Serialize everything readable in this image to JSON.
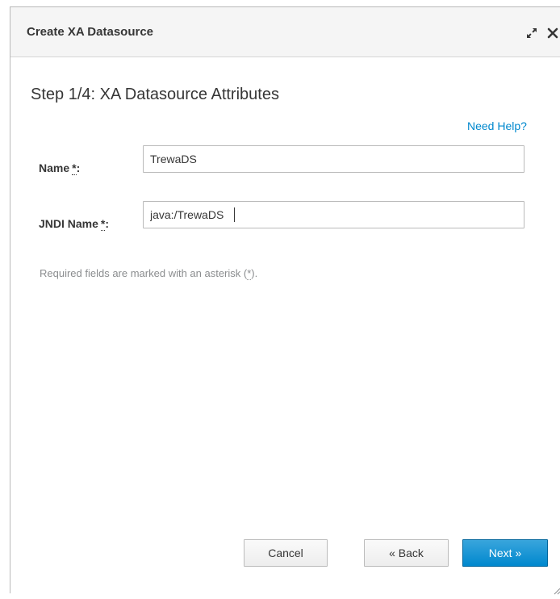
{
  "dialog": {
    "title": "Create XA Datasource"
  },
  "step": {
    "title": "Step 1/4: XA Datasource Attributes"
  },
  "help": {
    "label": "Need Help?"
  },
  "fields": {
    "name": {
      "label": "Name",
      "required_mark": "*",
      "colon": ":",
      "value": "TrewaDS"
    },
    "jndi": {
      "label": "JNDI Name",
      "required_mark": "*",
      "colon": ":",
      "value": "java:/TrewaDS"
    }
  },
  "note": {
    "prefix": "Required fields are marked with an asterisk (",
    "mark": "*",
    "suffix": ")."
  },
  "buttons": {
    "cancel": "Cancel",
    "back": "« Back",
    "next": "Next »"
  },
  "colors": {
    "accent": "#0088ce",
    "header_bg": "#f5f5f5",
    "text": "#363636"
  },
  "icons": {
    "maximize": "maximize-icon",
    "close": "close-icon",
    "resize": "resize-handle-icon"
  }
}
